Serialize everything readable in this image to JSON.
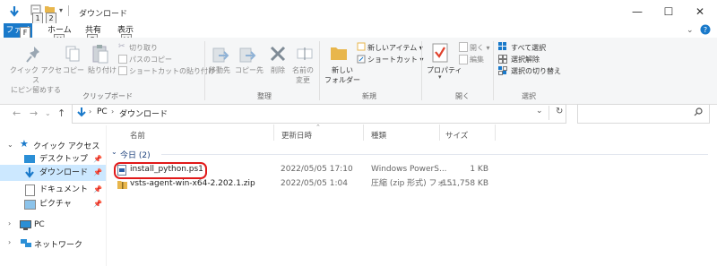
{
  "window": {
    "title": "ダウンロード",
    "keytips": [
      "1",
      "2"
    ]
  },
  "tabs": [
    {
      "label": "ファイル",
      "keytip": "F"
    },
    {
      "label": "ホーム",
      "keytip": "H"
    },
    {
      "label": "共有",
      "keytip": "S"
    },
    {
      "label": "表示",
      "keytip": "V"
    }
  ],
  "ribbon": {
    "clipboard": {
      "pin_label": "クイック アクセス",
      "pin_label2": "にピン留めする",
      "copy": "コピー",
      "paste": "貼り付け",
      "cut": "切り取り",
      "copy_path": "パスのコピー",
      "paste_shortcut": "ショートカットの貼り付け",
      "group": "クリップボード"
    },
    "organize": {
      "move_to": "移動先",
      "copy_to": "コピー先",
      "delete": "削除",
      "rename": "名前の",
      "rename2": "変更",
      "group": "整理"
    },
    "new": {
      "new_item": "新しいアイテム",
      "shortcut": "ショートカット",
      "new_folder": "新しい",
      "new_folder2": "フォルダー",
      "group": "新規"
    },
    "open": {
      "properties": "プロパティ",
      "open": "開く",
      "edit": "編集",
      "group": "開く"
    },
    "select": {
      "select_all": "すべて選択",
      "select_none": "選択解除",
      "invert": "選択の切り替え",
      "group": "選択"
    }
  },
  "address": {
    "crumbs": [
      "PC",
      "ダウンロード"
    ]
  },
  "nav": {
    "quick_access": "クイック アクセス",
    "items": [
      {
        "label": "デスクトップ"
      },
      {
        "label": "ダウンロード"
      },
      {
        "label": "ドキュメント"
      },
      {
        "label": "ピクチャ"
      }
    ],
    "pc": "PC",
    "network": "ネットワーク"
  },
  "columns": {
    "name": "名前",
    "modified": "更新日時",
    "type": "種類",
    "size": "サイズ"
  },
  "group_header": "今日 (2)",
  "files": [
    {
      "name": "install_python.ps1",
      "modified": "2022/05/05 17:10",
      "type": "Windows PowerS...",
      "size": "1 KB"
    },
    {
      "name": "vsts-agent-win-x64-2.202.1.zip",
      "modified": "2022/05/05 1:04",
      "type": "圧縮 (zip 形式) フォ...",
      "size": "151,758 KB"
    }
  ],
  "colors": {
    "accent": "#1979ca",
    "selection": "#cce8ff",
    "highlight": "#e11a1a"
  }
}
